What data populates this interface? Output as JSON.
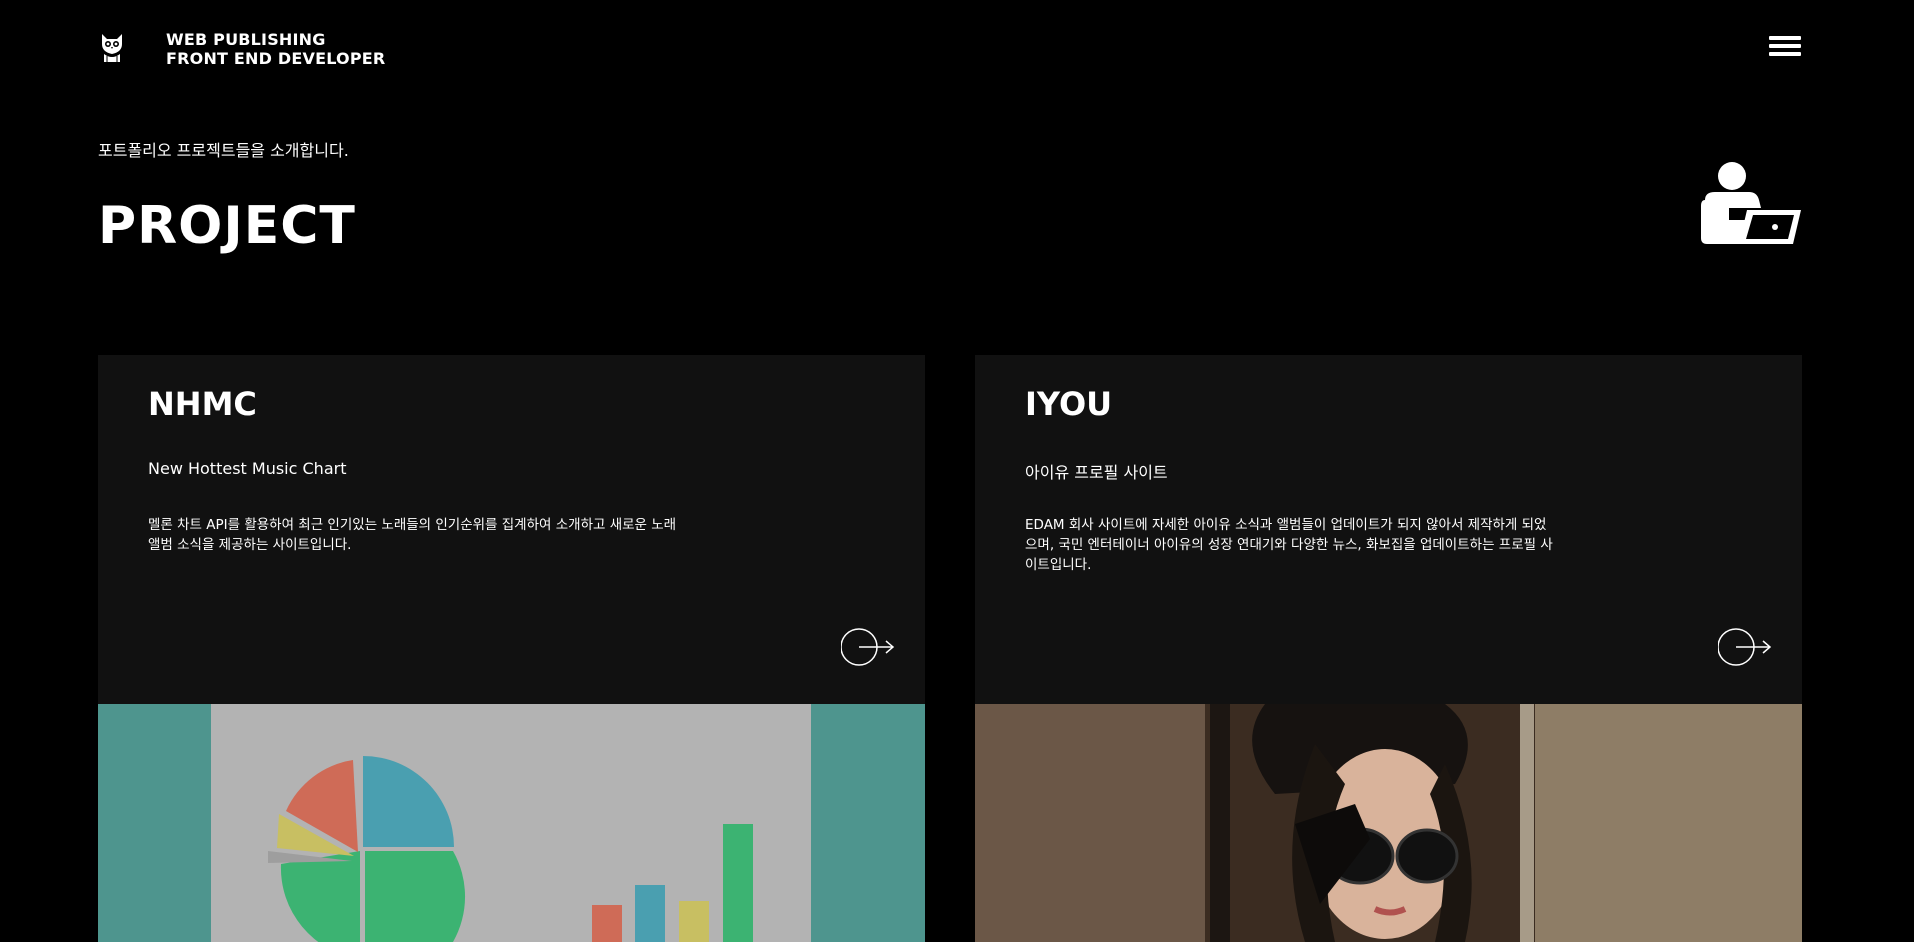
{
  "header": {
    "brand_line1": "WEB PUBLISHING",
    "brand_line2": "FRONT END DEVELOPER"
  },
  "intro": "포트폴리오 프로젝트들을 소개합니다.",
  "page_title": "PROJECT",
  "projects": [
    {
      "title": "NHMC",
      "subtitle": "New Hottest Music Chart",
      "description": "멜론 차트 API를 활용하여 최근 인기있는 노래들의 인기순위를 집계하여 소개하고 새로운 노래 앨범 소식을 제공하는 사이트입니다."
    },
    {
      "title": "IYOU",
      "subtitle": "아이유 프로필 사이트",
      "description": "EDAM 회사 사이트에 자세한 아이유 소식과 앨범들이 업데이트가 되지 않아서 제작하게 되었으며, 국민 엔터테이너 아이유의 성장 연대기와 다양한 뉴스, 화보집을 업데이트하는 프로필 사이트입니다."
    }
  ],
  "colors": {
    "background": "#000000",
    "card": "#111111",
    "thumb1_bg": "#4e958e"
  },
  "icons": [
    "owl-logo-icon",
    "hamburger-menu-icon",
    "person-laptop-icon",
    "arrow-right-circle-icon"
  ]
}
